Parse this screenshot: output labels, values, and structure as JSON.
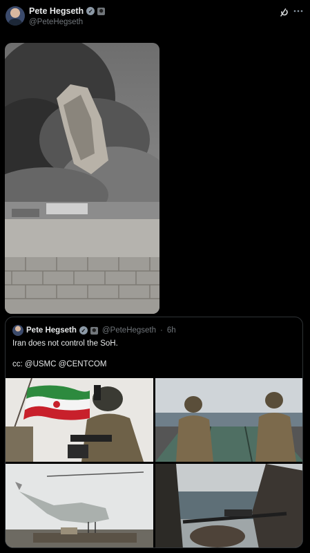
{
  "post": {
    "author_name": "Pete Hegseth",
    "author_handle": "@PeteHegseth",
    "main_media_alt": "Explosion image"
  },
  "quote": {
    "author_name": "Pete Hegseth",
    "author_handle": "@PeteHegseth",
    "separator": "·",
    "time_ago": "6h",
    "text_line1": "Iran does not control the SoH.",
    "text_line2": "cc: @USMC @CENTCOM"
  },
  "icons": {
    "verified": "verified-check-icon",
    "gov_badge": "government-badge-icon",
    "grok": "grok-icon",
    "more": "more-options-icon"
  },
  "colors": {
    "background": "#000000",
    "text_primary": "#e7e9ea",
    "text_secondary": "#71767b",
    "border": "#2f3336"
  }
}
